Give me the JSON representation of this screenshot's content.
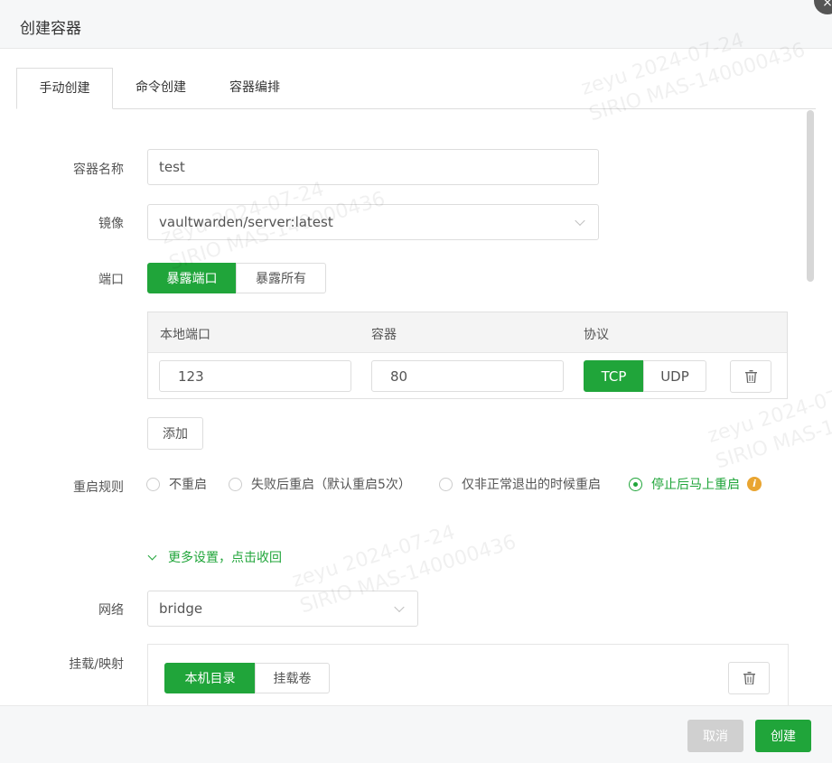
{
  "dialog": {
    "title": "创建容器",
    "close_icon": "×"
  },
  "tabs": [
    {
      "label": "手动创建",
      "active": true
    },
    {
      "label": "命令创建",
      "active": false
    },
    {
      "label": "容器编排",
      "active": false
    }
  ],
  "form": {
    "name": {
      "label": "容器名称",
      "value": "test"
    },
    "image": {
      "label": "镜像",
      "value": "vaultwarden/server:latest"
    },
    "port": {
      "label": "端口",
      "modes": [
        "暴露端口",
        "暴露所有"
      ],
      "selected_mode": "暴露端口",
      "columns": [
        "本地端口",
        "容器",
        "协议"
      ],
      "rows": [
        {
          "local": "123",
          "container": "80",
          "protocols": [
            "TCP",
            "UDP"
          ],
          "selected": "TCP"
        }
      ],
      "add_label": "添加"
    },
    "restart": {
      "label": "重启规则",
      "options": [
        "不重启",
        "失败后重启（默认重启5次）",
        "仅非正常退出的时候重启",
        "停止后马上重启"
      ],
      "selected": "停止后马上重启",
      "info_icon": "i"
    },
    "more_settings": "更多设置，点击收回",
    "network": {
      "label": "网络",
      "value": "bridge"
    },
    "mount": {
      "label": "挂载/映射",
      "modes": [
        "本机目录",
        "挂载卷"
      ],
      "selected_mode": "本机目录"
    }
  },
  "footer": {
    "cancel": "取消",
    "create": "创建"
  },
  "watermark": {
    "line1": "zeyu  2024-07-24",
    "line2": "SIRIO  MAS-140000436"
  },
  "colors": {
    "accent": "#20a53a",
    "info": "#e9a531",
    "disabled": "#d0d0d0"
  }
}
